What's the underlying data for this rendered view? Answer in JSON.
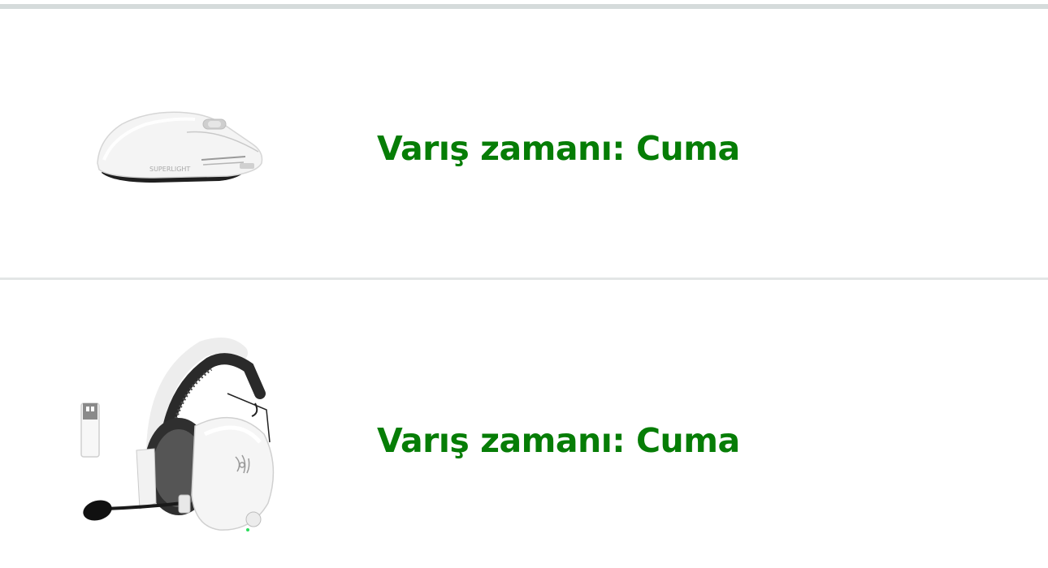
{
  "items": [
    {
      "image_alt": "white wireless gaming mouse",
      "image_logo_text": "SUPERLIGHT",
      "delivery_text": "Varış zamanı: Cuma"
    },
    {
      "image_alt": "white wireless gaming headset with microphone and USB dongle",
      "delivery_text": "Varış zamanı: Cuma"
    }
  ],
  "colors": {
    "delivery_text": "#067d06",
    "top_rule": "#d5dbdb",
    "divider": "#e3e6e6"
  }
}
